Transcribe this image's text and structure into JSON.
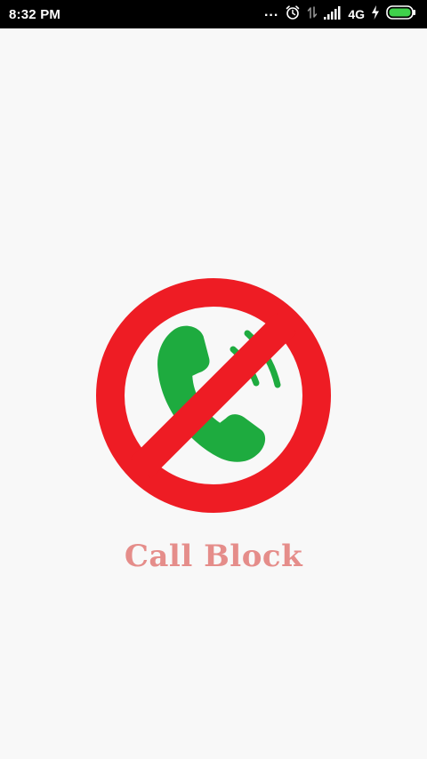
{
  "status_bar": {
    "time": "8:32 PM",
    "dots": "...",
    "network": "4G",
    "icons": [
      "alarm-icon",
      "data-arrows-icon",
      "signal-icon",
      "charging-bolt-icon",
      "battery-icon"
    ]
  },
  "splash": {
    "app_name": "Call Block",
    "logo_icon": "blocked-phone-icon",
    "colors": {
      "background": "#f8f8f8",
      "prohibition_red": "#ee1c24",
      "phone_green": "#1eab3f",
      "app_name": "#e58d8a",
      "battery_green": "#3fd24b"
    }
  }
}
